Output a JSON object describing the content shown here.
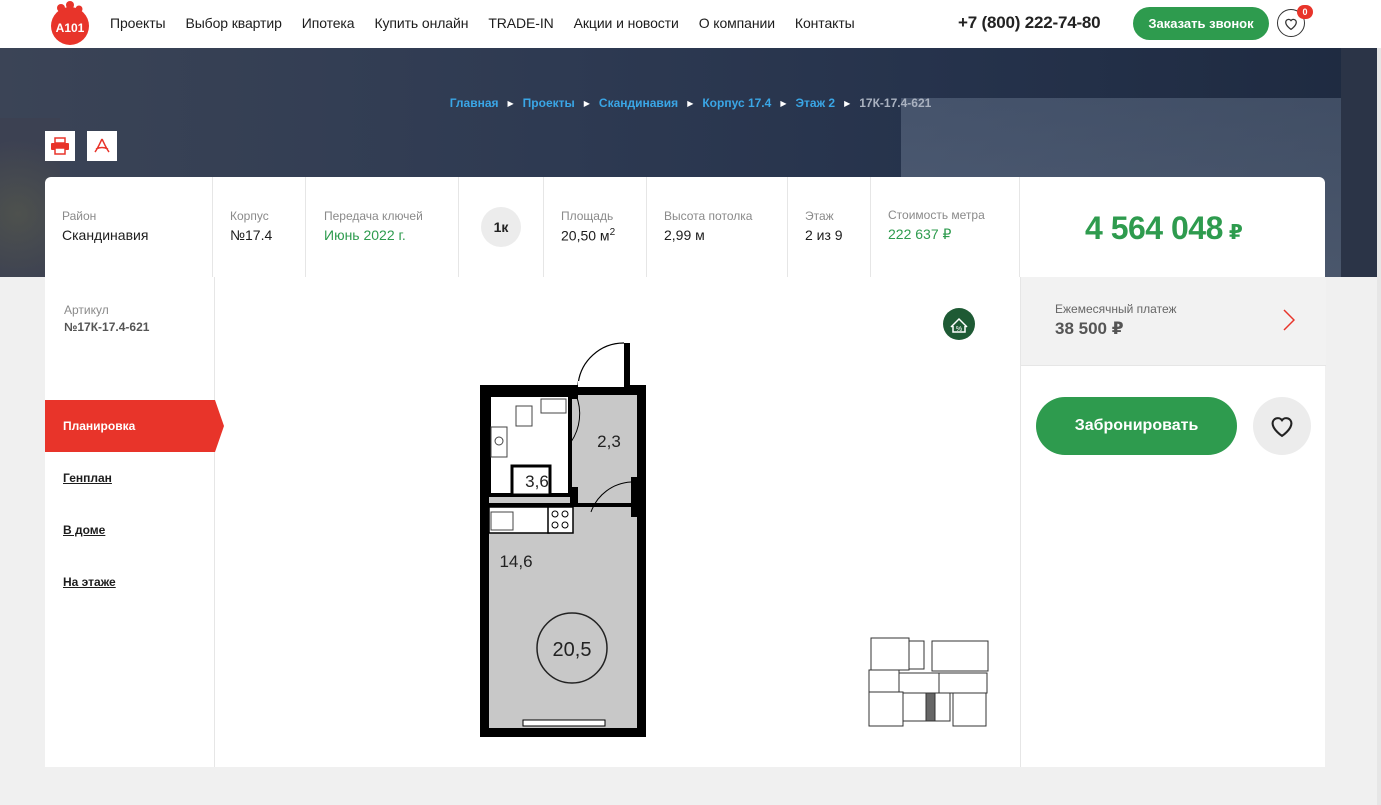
{
  "brand": {
    "logo_text": "A101",
    "accent": "#e8342a",
    "green": "#2e9b4e"
  },
  "nav": {
    "items": [
      "Проекты",
      "Выбор квартир",
      "Ипотека",
      "Купить онлайн",
      "TRADE-IN",
      "Акции и новости",
      "О компании",
      "Контакты"
    ],
    "phone": "+7 (800) 222-74-80",
    "call_label": "Заказать звонок",
    "fav_count": "0"
  },
  "breadcrumbs": {
    "items": [
      "Главная",
      "Проекты",
      "Скандинавия",
      "Корпус 17.4",
      "Этаж 2"
    ],
    "current": "17К-17.4-621"
  },
  "info": {
    "district_label": "Район",
    "district": "Скандинавия",
    "building_label": "Корпус",
    "building": "№17.4",
    "keys_label": "Передача ключей",
    "keys": "Июнь 2022 г.",
    "rooms": "1к",
    "area_label": "Площадь",
    "area": "20,50 м",
    "area_sup": "2",
    "ceiling_label": "Высота потолка",
    "ceiling": "2,99 м",
    "floor_label": "Этаж",
    "floor": "2 из 9",
    "sqm_label": "Стоимость метра",
    "sqm_price": "222 637 ₽",
    "price": "4 564 048",
    "currency": "₽"
  },
  "sidebar": {
    "article_label": "Артикул",
    "article": "№17К-17.4-621",
    "tabs": [
      "Планировка",
      "Генплан",
      "В доме",
      "На этаже"
    ]
  },
  "plan": {
    "rooms": [
      "2,3",
      "3,6",
      "14,6"
    ],
    "total": "20,5"
  },
  "right": {
    "monthly_label": "Ежемесячный платеж",
    "monthly_value": "38 500 ₽",
    "book_label": "Забронировать"
  }
}
